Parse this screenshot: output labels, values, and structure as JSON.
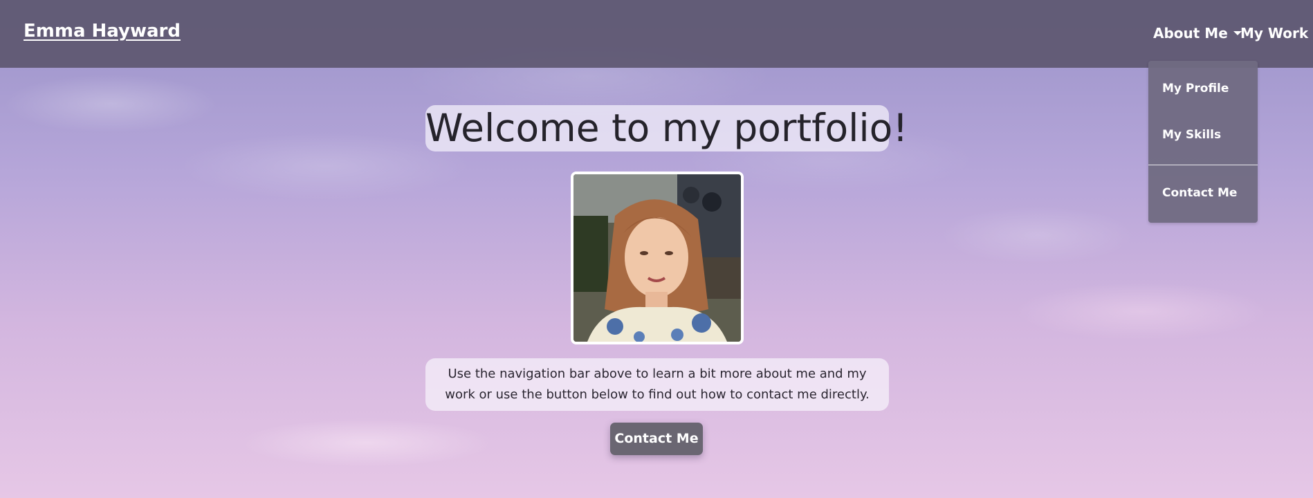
{
  "navbar": {
    "brand": "Emma Hayward",
    "links": [
      {
        "label": "About Me",
        "has_caret": true
      },
      {
        "label": "My Work"
      }
    ],
    "dropdown": {
      "items": [
        "My Profile",
        "My Skills",
        "Contact Me"
      ]
    }
  },
  "hero": {
    "title": "Welcome to my portfolio!",
    "intro": "Use the navigation bar above to learn a bit more about me and my work or use the button below to find out how to contact me directly.",
    "button_label": "Contact Me"
  },
  "icons": {
    "caret": "caret-down-icon"
  },
  "colors": {
    "navbar": "#5d5770",
    "dropdown": "#706a82",
    "button": "#6a6672",
    "sky_top": "#9a93c9",
    "sky_bottom": "#e6c7e6"
  }
}
